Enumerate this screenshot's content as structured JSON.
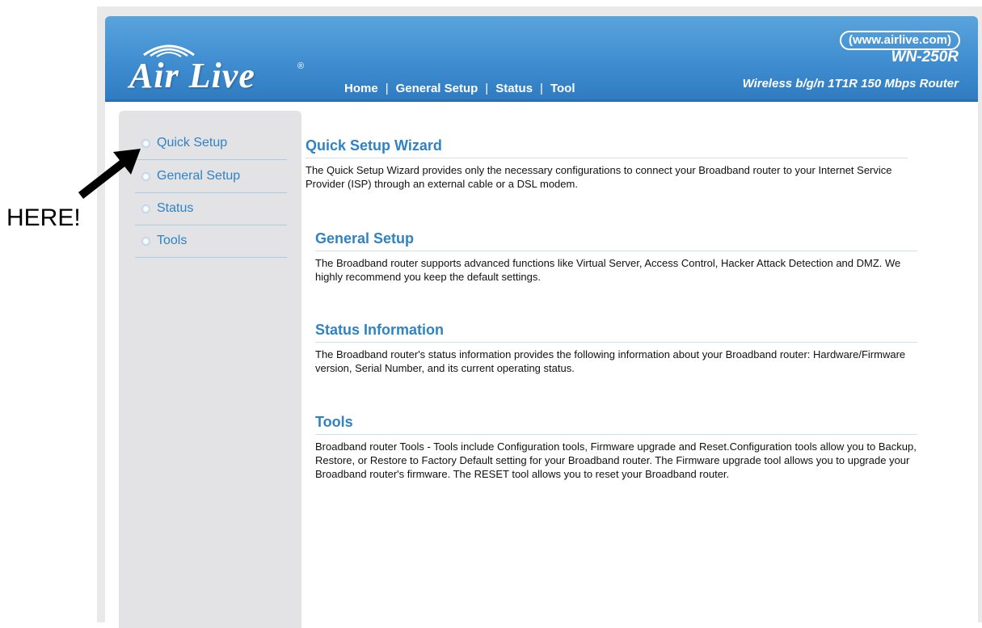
{
  "header": {
    "logo_text": "Air Live",
    "logo_reg": "®",
    "nav": [
      "Home",
      "General Setup",
      "Status",
      "Tool"
    ],
    "url": "(www.airlive.com)",
    "model": "WN-250R",
    "description": "Wireless b/g/n 1T1R 150 Mbps Router"
  },
  "sidebar": {
    "items": [
      {
        "label": "Quick Setup"
      },
      {
        "label": "General Setup"
      },
      {
        "label": "Status"
      },
      {
        "label": "Tools"
      }
    ]
  },
  "annotation": {
    "label": "HERE!"
  },
  "main": {
    "sections": [
      {
        "title": "Quick Setup Wizard",
        "text": "The Quick Setup Wizard provides only the necessary configurations to connect your Broadband router to your Internet Service Provider (ISP) through an external cable or a DSL modem."
      },
      {
        "title": "General Setup",
        "text": "The Broadband router supports advanced functions like Virtual Server, Access Control, Hacker Attack Detection and DMZ. We highly recommend you keep the default settings."
      },
      {
        "title": "Status Information",
        "text": "The Broadband router's status information provides the following information about your Broadband router: Hardware/Firmware version, Serial Number, and its current operating status."
      },
      {
        "title": "Tools",
        "text": "Broadband router Tools - Tools include Configuration tools, Firmware upgrade and Reset.Configuration tools allow you to Backup, Restore, or Restore to Factory Default setting for your Broadband router. The Firmware upgrade tool allows you to upgrade your Broadband router's firmware. The RESET tool allows you to reset your Broadband router."
      }
    ]
  }
}
